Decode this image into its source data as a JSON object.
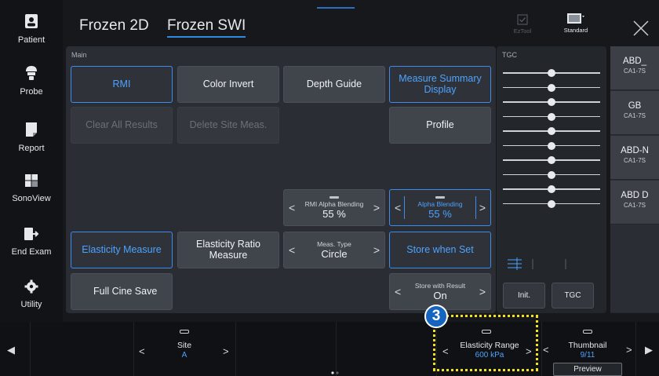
{
  "sidebar": {
    "items": [
      {
        "label": "Patient",
        "icon": "patient-icon"
      },
      {
        "label": "Probe",
        "icon": "probe-icon"
      },
      {
        "label": "Report",
        "icon": "report-icon"
      },
      {
        "label": "SonoView",
        "icon": "sonoview-icon"
      },
      {
        "label": "End Exam",
        "icon": "end-exam-icon"
      },
      {
        "label": "Utility",
        "icon": "gear-icon"
      }
    ]
  },
  "tabs": [
    {
      "label": "Frozen 2D",
      "active": false
    },
    {
      "label": "Frozen SWI",
      "active": true
    }
  ],
  "top_controls": {
    "eztool_label": "EzTool",
    "standard_label": "Standard",
    "close_icon": "close-icon"
  },
  "main": {
    "title": "Main",
    "buttons": {
      "rmi": "RMI",
      "color_invert": "Color Invert",
      "depth_guide": "Depth Guide",
      "measure_summary": "Measure Summary Display",
      "clear_all": "Clear All Results",
      "delete_site": "Delete Site Meas.",
      "profile": "Profile",
      "elasticity_measure": "Elasticity Measure",
      "elasticity_ratio": "Elasticity Ratio Measure",
      "store_when_set": "Store when Set",
      "full_cine_save": "Full Cine Save"
    },
    "selectors": {
      "rmi_alpha": {
        "label": "RMI Alpha Blending",
        "value": "55 %"
      },
      "alpha": {
        "label": "Alpha Blending",
        "value": "55 %"
      },
      "meas_type": {
        "label": "Meas. Type",
        "value": "Circle"
      },
      "store_result": {
        "label": "Store with Result",
        "value": "On"
      }
    }
  },
  "tgc": {
    "title": "TGC",
    "levels": [
      0.5,
      0.5,
      0.5,
      0.5,
      0.5,
      0.5,
      0.5,
      0.5,
      0.5,
      0.5
    ],
    "init_label": "Init.",
    "tgc_label": "TGC"
  },
  "probes": [
    {
      "name": "ABD_",
      "sub": "CA1-7S"
    },
    {
      "name": "GB",
      "sub": "CA1-7S"
    },
    {
      "name": "ABD-N",
      "sub": "CA1-7S"
    },
    {
      "name": "ABD D",
      "sub": "CA1-7S"
    }
  ],
  "bottom": {
    "site": {
      "label": "Site",
      "value": "A"
    },
    "elasticity_range": {
      "label": "Elasticity Range",
      "value": "600 kPa"
    },
    "thumbnail": {
      "label": "Thumbnail",
      "value": "9/11"
    },
    "preview_label": "Preview",
    "callout_number": "3"
  },
  "colors": {
    "accent": "#4da3ff",
    "callout": "#f3e21a",
    "badge": "#1565c0"
  }
}
